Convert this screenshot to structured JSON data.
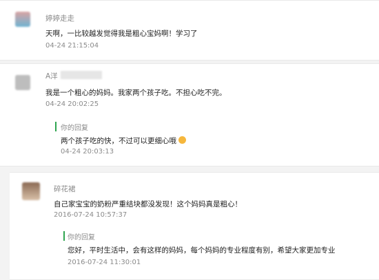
{
  "comments": [
    {
      "user": "婷婷走走",
      "text": "天啊，一比较越发觉得我是粗心宝妈啊！学习了",
      "time": "04-24 21:15:04"
    },
    {
      "user": "A洋",
      "text": "我是一个粗心的妈妈。我家两个孩子吃。不担心吃不完。",
      "time": "04-24 20:02:25",
      "reply": {
        "label": "你的回复",
        "text": "两个孩子吃的快，不过可以更细心哦",
        "time": "04-24 20:03:13"
      }
    },
    {
      "user": "碎花裙",
      "text": "自己家宝宝的奶粉严重结块都没发现！这个妈妈真是粗心！",
      "time": "2016-07-24 10:57:37",
      "reply": {
        "label": "你的回复",
        "text": "您好，平时生活中，会有这样的妈妈，每个妈妈的专业程度有别，希望大家更加专业",
        "time": "2016-07-24 11:30:01"
      }
    }
  ],
  "colors": {
    "reply_bar": "#2ea44f",
    "background": "#f3f3f3"
  }
}
